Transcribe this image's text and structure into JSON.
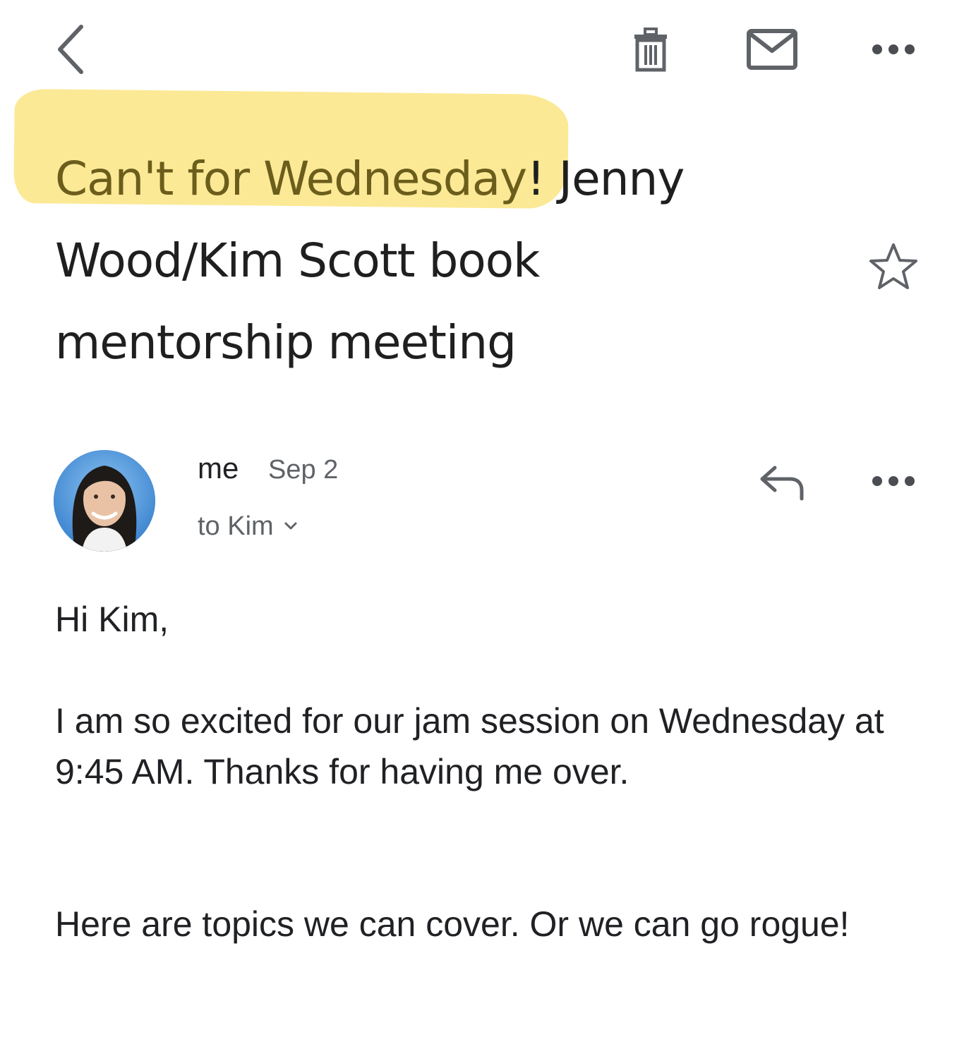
{
  "toolbar": {
    "back_icon": "chevron-left-icon",
    "delete_icon": "trash-icon",
    "mark_unread_icon": "envelope-icon",
    "more_icon": "more-horizontal-icon"
  },
  "subject": {
    "highlighted": "Can't for Wednesday",
    "rest_line1": "! Jenny",
    "line2": "Wood/Kim Scott book",
    "line3": "mentorship meeting",
    "highlight_color": "#fbe78b",
    "star_icon": "star-outline-icon"
  },
  "message": {
    "sender": "me",
    "date": "Sep 2",
    "recipients": "to Kim",
    "reply_icon": "reply-icon",
    "more_icon": "more-horizontal-icon",
    "greeting": "Hi Kim,",
    "paragraph1": "I am so excited for our jam session on Wednesday at 9:45 AM. Thanks for having me over.",
    "paragraph2": "Here are topics we can cover. Or we can go rogue!"
  }
}
